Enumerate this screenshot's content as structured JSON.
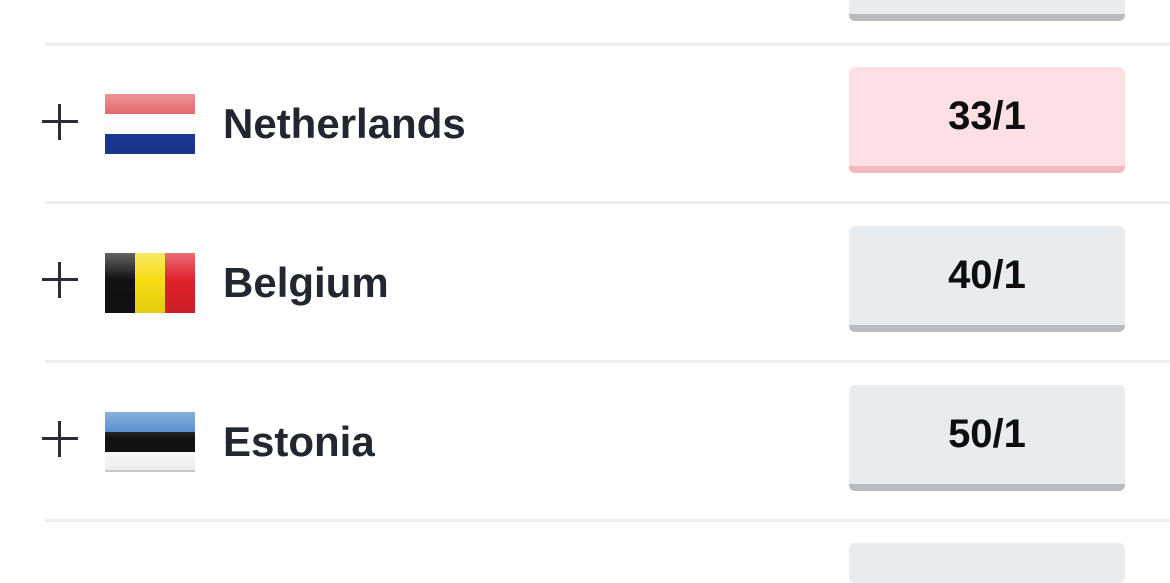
{
  "rows": [
    {
      "country": "Netherlands",
      "odds": "33/1",
      "flag_icon": "netherlands-flag-icon",
      "selected": true
    },
    {
      "country": "Belgium",
      "odds": "40/1",
      "flag_icon": "belgium-flag-icon",
      "selected": false
    },
    {
      "country": "Estonia",
      "odds": "50/1",
      "flag_icon": "estonia-flag-icon",
      "selected": false
    }
  ],
  "colors": {
    "text": "#222630",
    "odds_default_bg": "#e9ecef",
    "odds_selected_bg": "#fde0e3",
    "divider": "#eceef0"
  }
}
